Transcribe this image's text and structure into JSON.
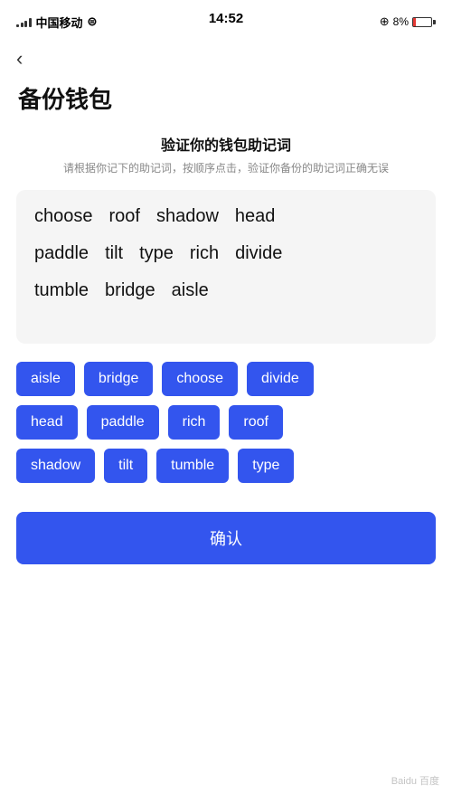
{
  "statusBar": {
    "carrier": "中国移动",
    "time": "14:52",
    "batteryPercent": "8%"
  },
  "back": "‹",
  "pageTitle": "备份钱包",
  "sectionHeading": "验证你的钱包助记词",
  "sectionDesc": "请根据你记下的助记词，按顺序点击，验证你备份的助记词正确无误",
  "displayWords": [
    [
      "choose",
      "roof",
      "shadow",
      "head"
    ],
    [
      "paddle",
      "tilt",
      "type",
      "rich",
      "divide"
    ],
    [
      "tumble",
      "bridge",
      "aisle"
    ]
  ],
  "chips": [
    [
      "aisle",
      "bridge",
      "choose",
      "divide"
    ],
    [
      "head",
      "paddle",
      "rich",
      "roof"
    ],
    [
      "shadow",
      "tilt",
      "tumble",
      "type"
    ]
  ],
  "confirmLabel": "确认",
  "watermark": "Baidu 百度"
}
